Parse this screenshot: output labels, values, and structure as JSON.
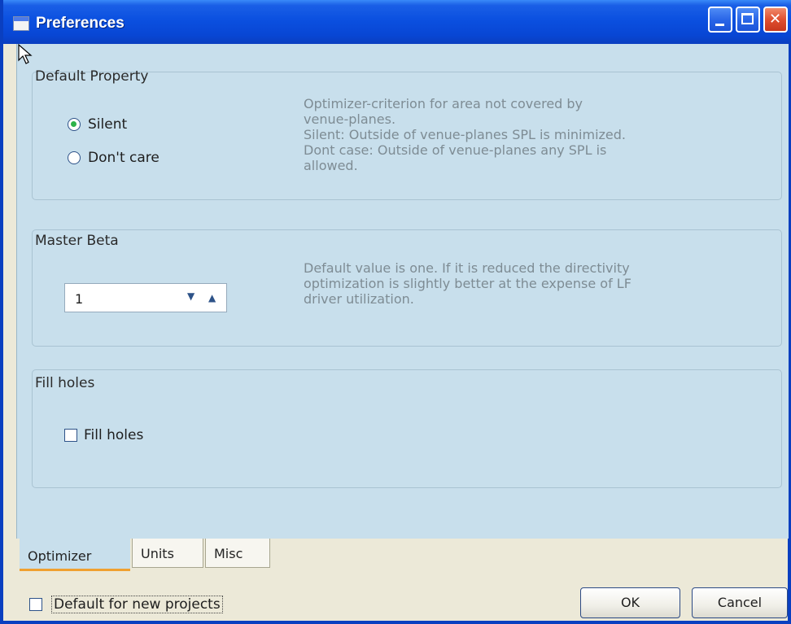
{
  "window": {
    "title": "Preferences"
  },
  "titlebar_buttons": {
    "minimize": "minimize-icon",
    "maximize": "maximize-icon",
    "close": "close-icon"
  },
  "groups": {
    "default_property": {
      "title": "Default Property",
      "options": [
        {
          "label": "Silent",
          "selected": true
        },
        {
          "label": "Don't care",
          "selected": false
        }
      ],
      "description_lines": [
        "Optimizer-criterion for area not covered by",
        "venue-planes.",
        "Silent: Outside of venue-planes SPL is minimized.",
        "Dont case: Outside of venue-planes any SPL is",
        "allowed."
      ]
    },
    "master_beta": {
      "title": "Master Beta",
      "value": "1",
      "description_lines": [
        "Default value is one. If it is reduced the directivity",
        "optimization is slightly better at the expense of LF",
        "driver utilization."
      ]
    },
    "fill_holes": {
      "title": "Fill holes",
      "checkbox_label": "Fill holes",
      "checked": false
    }
  },
  "tabs": [
    {
      "label": "Optimizer",
      "active": true
    },
    {
      "label": "Units",
      "active": false
    },
    {
      "label": "Misc",
      "active": false
    }
  ],
  "footer": {
    "default_checkbox_label": "Default for new projects",
    "default_checked": false,
    "ok_label": "OK",
    "cancel_label": "Cancel"
  },
  "colors": {
    "titlebar": "#0a4fd8",
    "panel_bg": "#c8dfec",
    "dialog_bg": "#ece9d8",
    "active_tab_accent": "#f0a030",
    "radio_selected": "#2db34a"
  }
}
